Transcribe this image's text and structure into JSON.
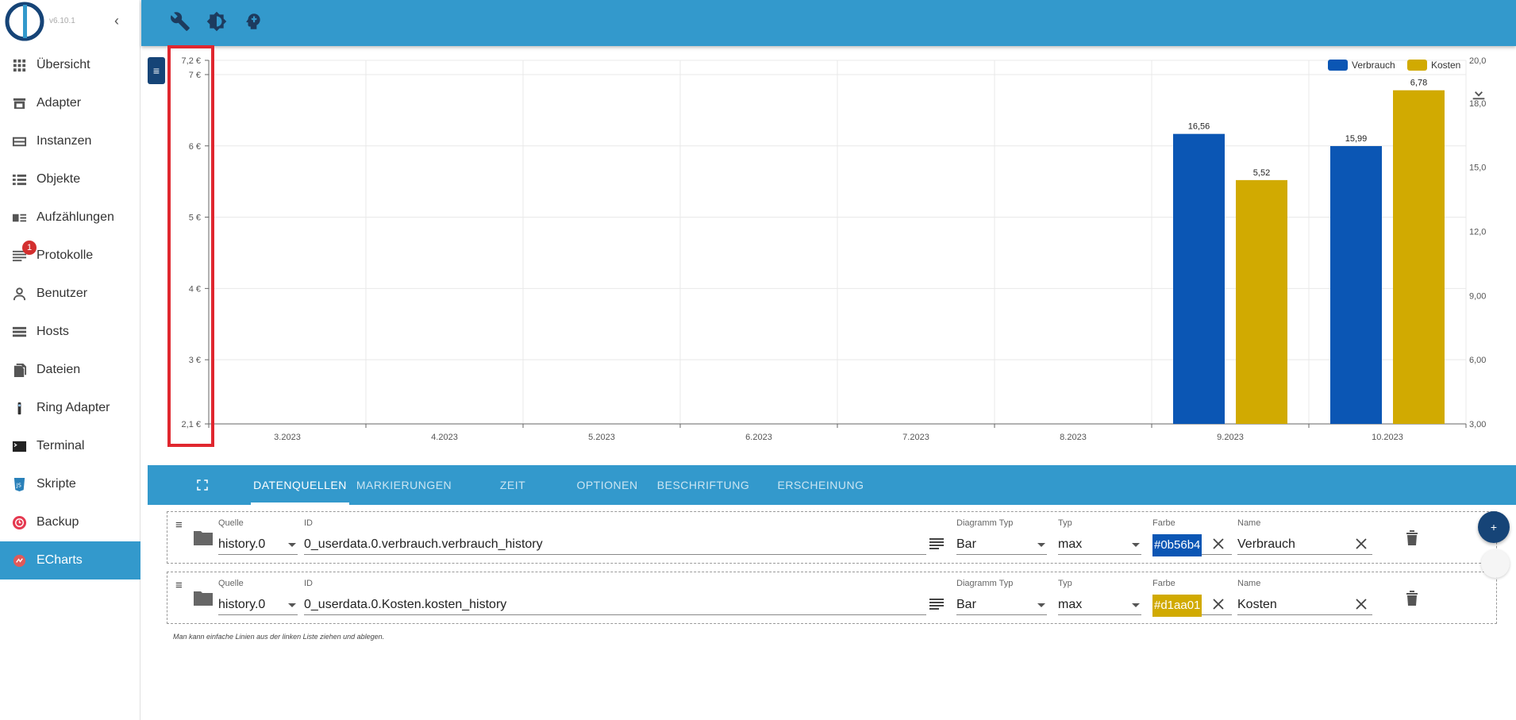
{
  "app": {
    "version": "v6.10.1",
    "accent": "#3399cc",
    "dark_accent": "#164477"
  },
  "sidebar": {
    "items": [
      {
        "label": "Übersicht",
        "icon": "grid-icon"
      },
      {
        "label": "Adapter",
        "icon": "store-icon"
      },
      {
        "label": "Instanzen",
        "icon": "instances-icon"
      },
      {
        "label": "Objekte",
        "icon": "list-icon"
      },
      {
        "label": "Aufzählungen",
        "icon": "enum-icon"
      },
      {
        "label": "Protokolle",
        "icon": "log-icon",
        "badge": "1"
      },
      {
        "label": "Benutzer",
        "icon": "user-icon"
      },
      {
        "label": "Hosts",
        "icon": "hosts-icon"
      },
      {
        "label": "Dateien",
        "icon": "files-icon"
      },
      {
        "label": "Ring Adapter",
        "icon": "ring-icon"
      },
      {
        "label": "Terminal",
        "icon": "terminal-icon"
      },
      {
        "label": "Skripte",
        "icon": "js-icon"
      },
      {
        "label": "Backup",
        "icon": "backup-icon"
      },
      {
        "label": "ECharts",
        "icon": "echarts-icon",
        "active": true
      }
    ]
  },
  "toolbar": {
    "icons": [
      "wrench-icon",
      "brightness-icon",
      "expert-mode-icon"
    ]
  },
  "chart_data": {
    "type": "bar",
    "categories": [
      "3.2023",
      "4.2023",
      "5.2023",
      "6.2023",
      "7.2023",
      "8.2023",
      "9.2023",
      "10.2023"
    ],
    "series": [
      {
        "name": "Verbrauch",
        "color": "#0b56b4",
        "axis": "right",
        "values": [
          null,
          null,
          null,
          null,
          null,
          null,
          16.56,
          15.99
        ]
      },
      {
        "name": "Kosten",
        "color": "#d1aa01",
        "axis": "left",
        "values": [
          null,
          null,
          null,
          null,
          null,
          null,
          5.52,
          6.78
        ]
      }
    ],
    "data_labels": [
      "16,56",
      "5,52",
      "15,99",
      "6,78"
    ],
    "left_axis": {
      "ylim": [
        2.1,
        7.2
      ],
      "ticks": [
        "7,2 €",
        "7 €",
        "6 €",
        "5 €",
        "4 €",
        "3 €",
        "2,1 €"
      ]
    },
    "right_axis": {
      "ylim": [
        3,
        20
      ],
      "ticks": [
        "20,0",
        "18,0",
        "15,0",
        "12,0",
        "9,00",
        "6,00",
        "3,00"
      ]
    },
    "legend_placement": "top-right",
    "grid": true
  },
  "tabs": [
    {
      "label": "DATENQUELLEN",
      "active": true
    },
    {
      "label": "MARKIERUNGEN"
    },
    {
      "label": "ZEIT"
    },
    {
      "label": "OPTIONEN"
    },
    {
      "label": "BESCHRIFTUNG"
    },
    {
      "label": "ERSCHEINUNG"
    }
  ],
  "labels": {
    "source": "Quelle",
    "id": "ID",
    "chart_type": "Diagramm Typ",
    "type": "Typ",
    "color": "Farbe",
    "name": "Name"
  },
  "rows": [
    {
      "source": "history.0",
      "id": "0_userdata.0.verbrauch.verbrauch_history",
      "chart_type": "Bar",
      "type": "max",
      "color": "#0b56b4",
      "name": "Verbrauch"
    },
    {
      "source": "history.0",
      "id": "0_userdata.0.Kosten.kosten_history",
      "chart_type": "Bar",
      "type": "max",
      "color": "#d1aa01",
      "name": "Kosten"
    }
  ],
  "hint": "Man kann einfache Linien aus der linken Liste ziehen und ablegen.",
  "add_label": "+"
}
